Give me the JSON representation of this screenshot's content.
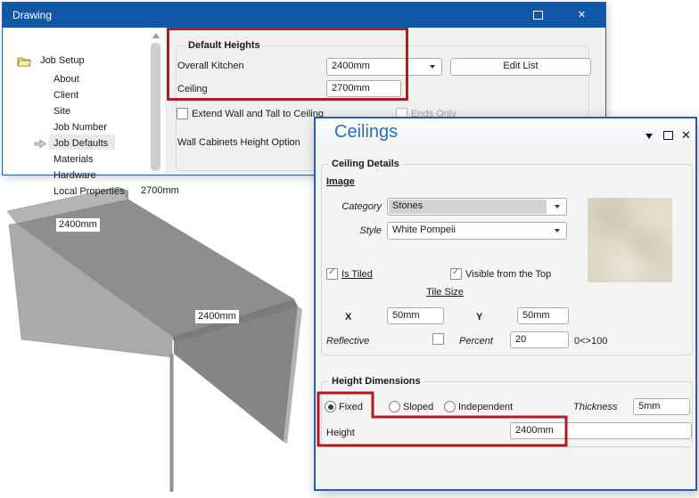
{
  "colors": {
    "title_bar_blue": "#1157a7",
    "dialog_border_blue": "#2b5da8",
    "ceilings_title_blue": "#2e6cb3",
    "annotation_red": "#b11a1f"
  },
  "drawing_window": {
    "title": "Drawing",
    "tree": {
      "root": "Job Setup",
      "items": [
        "About",
        "Client",
        "Site",
        "Job Number",
        "Job Defaults",
        "Materials",
        "Hardware",
        "Local Properties"
      ],
      "selected_item": "Job Defaults"
    },
    "default_heights": {
      "group_label": "Default Heights",
      "overall_kitchen_label": "Overall Kitchen",
      "overall_kitchen_value": "2400mm",
      "edit_list_label": "Edit List",
      "ceiling_label": "Ceiling",
      "ceiling_value": "2700mm"
    },
    "options": {
      "extend_label": "Extend Wall and Tall to Ceiling",
      "extend_checked": false,
      "ends_only_label": "Ends Only",
      "ends_only_checked": false,
      "ends_only_enabled": false,
      "wall_cabinets_label": "Wall Cabinets Height Option"
    }
  },
  "ceilings_window": {
    "title": "Ceilings",
    "ceiling_details": {
      "group_label": "Ceiling Details",
      "image_label": "Image",
      "category_label": "Category",
      "category_value": "Stones",
      "style_label": "Style",
      "style_value": "White Pompeii",
      "is_tiled_label": "Is Tiled",
      "is_tiled_checked": true,
      "visible_top_label": "Visible from the Top",
      "visible_top_checked": true,
      "tile_size_label": "Tile Size",
      "x_label": "X",
      "x_value": "50mm",
      "y_label": "Y",
      "y_value": "50mm",
      "reflective_label": "Reflective",
      "reflective_checked": false,
      "percent_label": "Percent",
      "percent_value": "20",
      "percent_range": "0<>100"
    },
    "height_dimensions": {
      "group_label": "Height Dimensions",
      "fixed_label": "Fixed",
      "sloped_label": "Sloped",
      "independent_label": "Independent",
      "selected_mode": "Fixed",
      "thickness_label": "Thickness",
      "thickness_value": "5mm",
      "height_label": "Height",
      "height_value": "2400mm"
    }
  },
  "viewport": {
    "back_wall_label": "2700mm",
    "left_ceiling_label": "2400mm",
    "right_wall_label": "2400mm"
  }
}
